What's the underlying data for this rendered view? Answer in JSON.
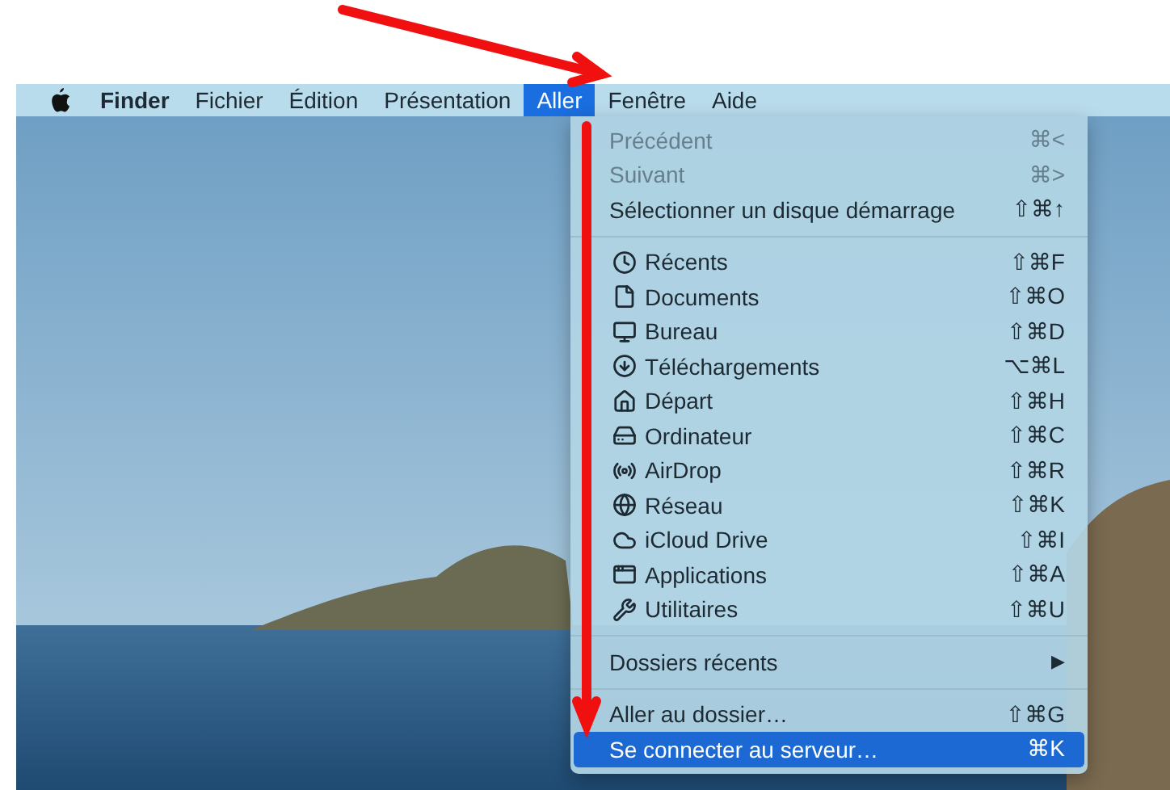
{
  "menubar": {
    "items": [
      {
        "label": "Finder",
        "bold": true,
        "selected": false
      },
      {
        "label": "Fichier",
        "bold": false,
        "selected": false
      },
      {
        "label": "Édition",
        "bold": false,
        "selected": false
      },
      {
        "label": "Présentation",
        "bold": false,
        "selected": false
      },
      {
        "label": "Aller",
        "bold": false,
        "selected": true
      },
      {
        "label": "Fenêtre",
        "bold": false,
        "selected": false
      },
      {
        "label": "Aide",
        "bold": false,
        "selected": false
      }
    ]
  },
  "menu": {
    "items": [
      {
        "kind": "plain",
        "label": "Précédent",
        "shortcut": "⌘<",
        "disabled": true,
        "selected": false
      },
      {
        "kind": "plain",
        "label": "Suivant",
        "shortcut": "⌘>",
        "disabled": true,
        "selected": false
      },
      {
        "kind": "plain",
        "label": "Sélectionner un disque démarrage",
        "shortcut": "⇧⌘↑",
        "disabled": false,
        "selected": false
      },
      {
        "kind": "separator"
      },
      {
        "kind": "icon",
        "label": "Récents",
        "shortcut": "⇧⌘F",
        "disabled": false,
        "selected": false
      },
      {
        "kind": "icon",
        "label": "Documents",
        "shortcut": "⇧⌘O",
        "disabled": false,
        "selected": false
      },
      {
        "kind": "icon",
        "label": "Bureau",
        "shortcut": "⇧⌘D",
        "disabled": false,
        "selected": false
      },
      {
        "kind": "icon",
        "label": "Téléchargements",
        "shortcut": "⌥⌘L",
        "disabled": false,
        "selected": false
      },
      {
        "kind": "icon",
        "label": "Départ",
        "shortcut": "⇧⌘H",
        "disabled": false,
        "selected": false
      },
      {
        "kind": "icon",
        "label": "Ordinateur",
        "shortcut": "⇧⌘C",
        "disabled": false,
        "selected": false
      },
      {
        "kind": "icon",
        "label": "AirDrop",
        "shortcut": "⇧⌘R",
        "disabled": false,
        "selected": false
      },
      {
        "kind": "icon",
        "label": "Réseau",
        "shortcut": "⇧⌘K",
        "disabled": false,
        "selected": false
      },
      {
        "kind": "icon",
        "label": "iCloud Drive",
        "shortcut": "⇧⌘I",
        "disabled": false,
        "selected": false
      },
      {
        "kind": "icon",
        "label": "Applications",
        "shortcut": "⇧⌘A",
        "disabled": false,
        "selected": false
      },
      {
        "kind": "icon",
        "label": "Utilitaires",
        "shortcut": "⇧⌘U",
        "disabled": false,
        "selected": false
      },
      {
        "kind": "separator"
      },
      {
        "kind": "submenu",
        "label": "Dossiers récents",
        "arrow": "▶",
        "disabled": false,
        "selected": false
      },
      {
        "kind": "separator"
      },
      {
        "kind": "plain",
        "label": "Aller au dossier…",
        "shortcut": "⇧⌘G",
        "disabled": false,
        "selected": false
      },
      {
        "kind": "plain",
        "label": "Se connecter au serveur…",
        "shortcut": "⌘K",
        "disabled": false,
        "selected": true
      }
    ]
  }
}
